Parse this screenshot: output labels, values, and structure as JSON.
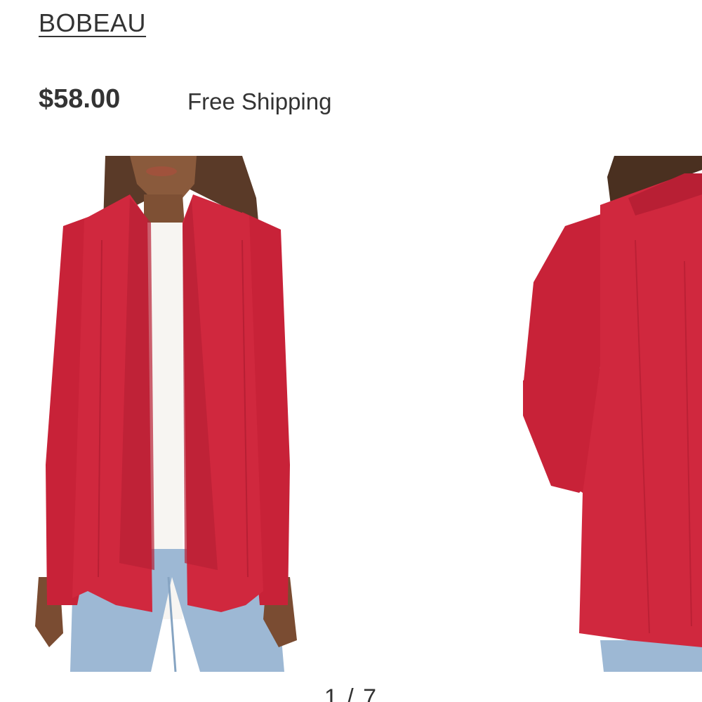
{
  "product": {
    "brand": "BOBEAU",
    "price": "$58.00",
    "shipping": "Free Shipping"
  },
  "gallery": {
    "current": "1",
    "separator": " / ",
    "total": "7",
    "slides": [
      {
        "icon": "cardigan-front-photo"
      },
      {
        "icon": "cardigan-back-photo"
      }
    ]
  },
  "colors": {
    "garment": "#d0283e",
    "text": "#333333"
  }
}
